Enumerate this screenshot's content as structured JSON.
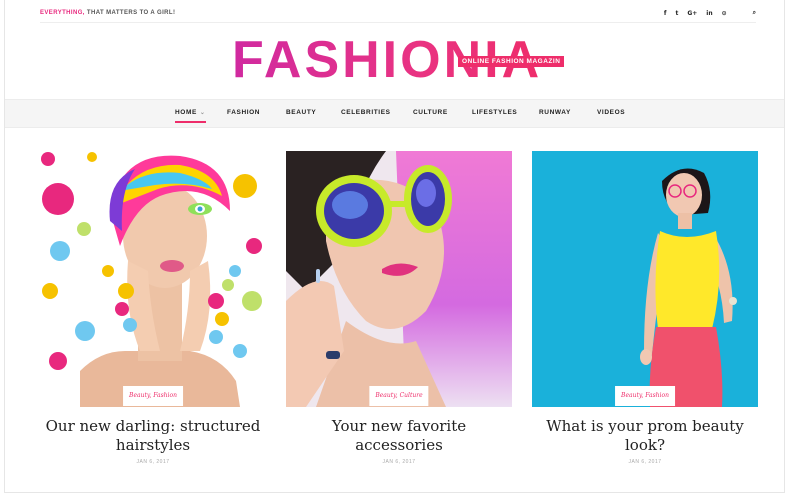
{
  "topbar": {
    "tagline_accent": "EVERYTHING,",
    "tagline_rest": " THAT MATTERS TO A GIRL!",
    "social_icons": [
      "facebook-icon",
      "twitter-icon",
      "google-plus-icon",
      "linkedin-icon",
      "pinterest-icon",
      "search-icon"
    ],
    "social_glyphs": [
      "f",
      "t",
      "G+",
      "in",
      "⊙",
      "⌕"
    ]
  },
  "logo": {
    "text": "FASHIONIA",
    "badge": "ONLINE FASHION MAGAZIN"
  },
  "nav": {
    "items": [
      {
        "label": "HOME",
        "active": true
      },
      {
        "label": "FASHION"
      },
      {
        "label": "BEAUTY"
      },
      {
        "label": "CELEBRITIES"
      },
      {
        "label": "CULTURE"
      },
      {
        "label": "LIFESTYLES"
      },
      {
        "label": "RUNWAY"
      },
      {
        "label": "VIDEOS"
      }
    ],
    "home_chevron": "⌄"
  },
  "posts": [
    {
      "category": "Beauty, Fashion",
      "title": "Our new darling: structured hairstyles",
      "date": "JAN 6, 2017"
    },
    {
      "category": "Beauty, Culture",
      "title": "Your new favorite accessories",
      "date": "JAN 6, 2017"
    },
    {
      "category": "Beauty, Fashion",
      "title": "What is your prom beauty look?",
      "date": "JAN 6, 2017"
    }
  ],
  "colors": {
    "accent": "#ee2d6a",
    "logo_gradient_start": "#d02aa0"
  }
}
